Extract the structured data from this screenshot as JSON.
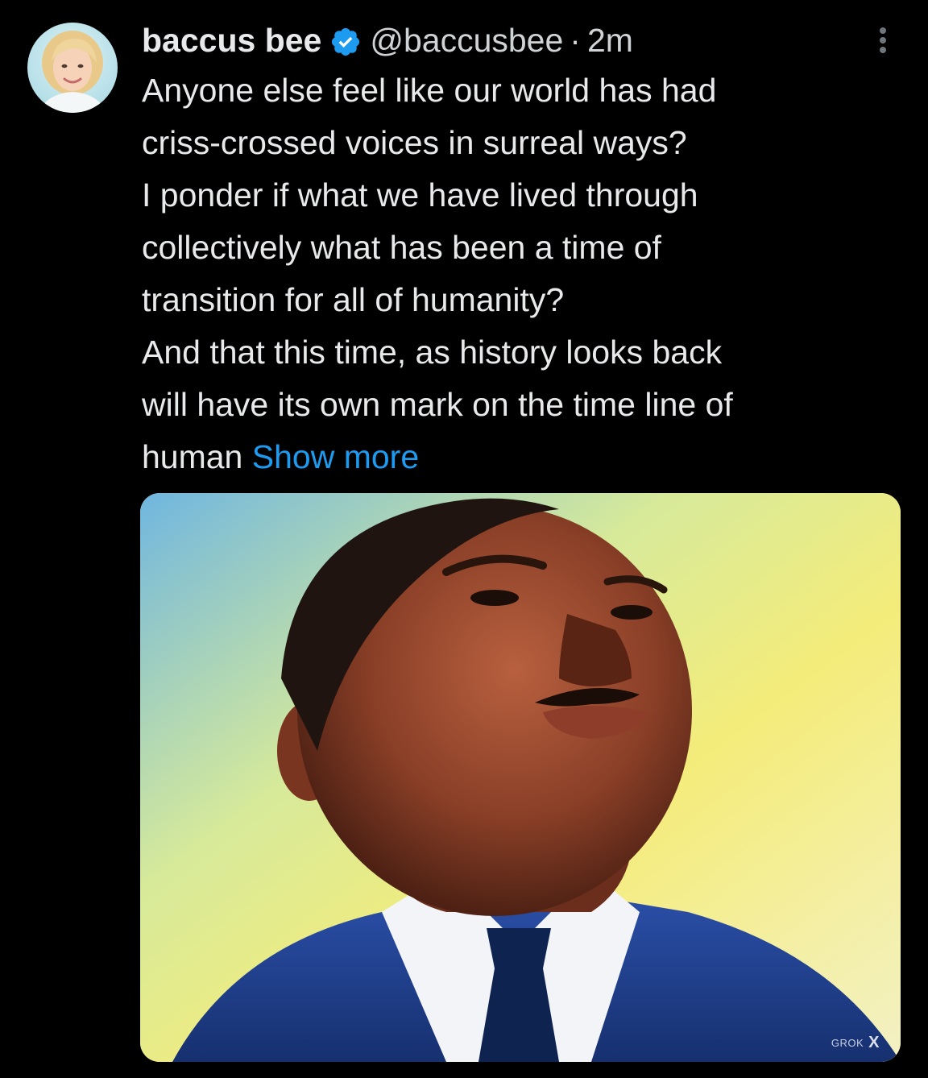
{
  "post": {
    "display_name": "baccus bee",
    "handle": "@baccusbee",
    "separator": "·",
    "time": "2m",
    "text_lines": [
      "Anyone else feel like our world has had",
      "criss-crossed voices in surreal ways?",
      "I ponder if what we have lived through",
      "collectively what has been a time of",
      "transition for all of humanity?",
      "And that this time, as history looks back",
      "will have its own mark on the time line of"
    ],
    "text_last_line": "human ",
    "show_more_label": "Show more"
  },
  "media": {
    "watermark_text": "GROK",
    "watermark_mark": "X"
  },
  "icons": {
    "verified": "verified-badge-icon",
    "more": "more-vertical-icon"
  },
  "colors": {
    "background": "#000000",
    "text": "#e7e9ea",
    "link": "#1d9bf0",
    "verified": "#1d9bf0"
  }
}
